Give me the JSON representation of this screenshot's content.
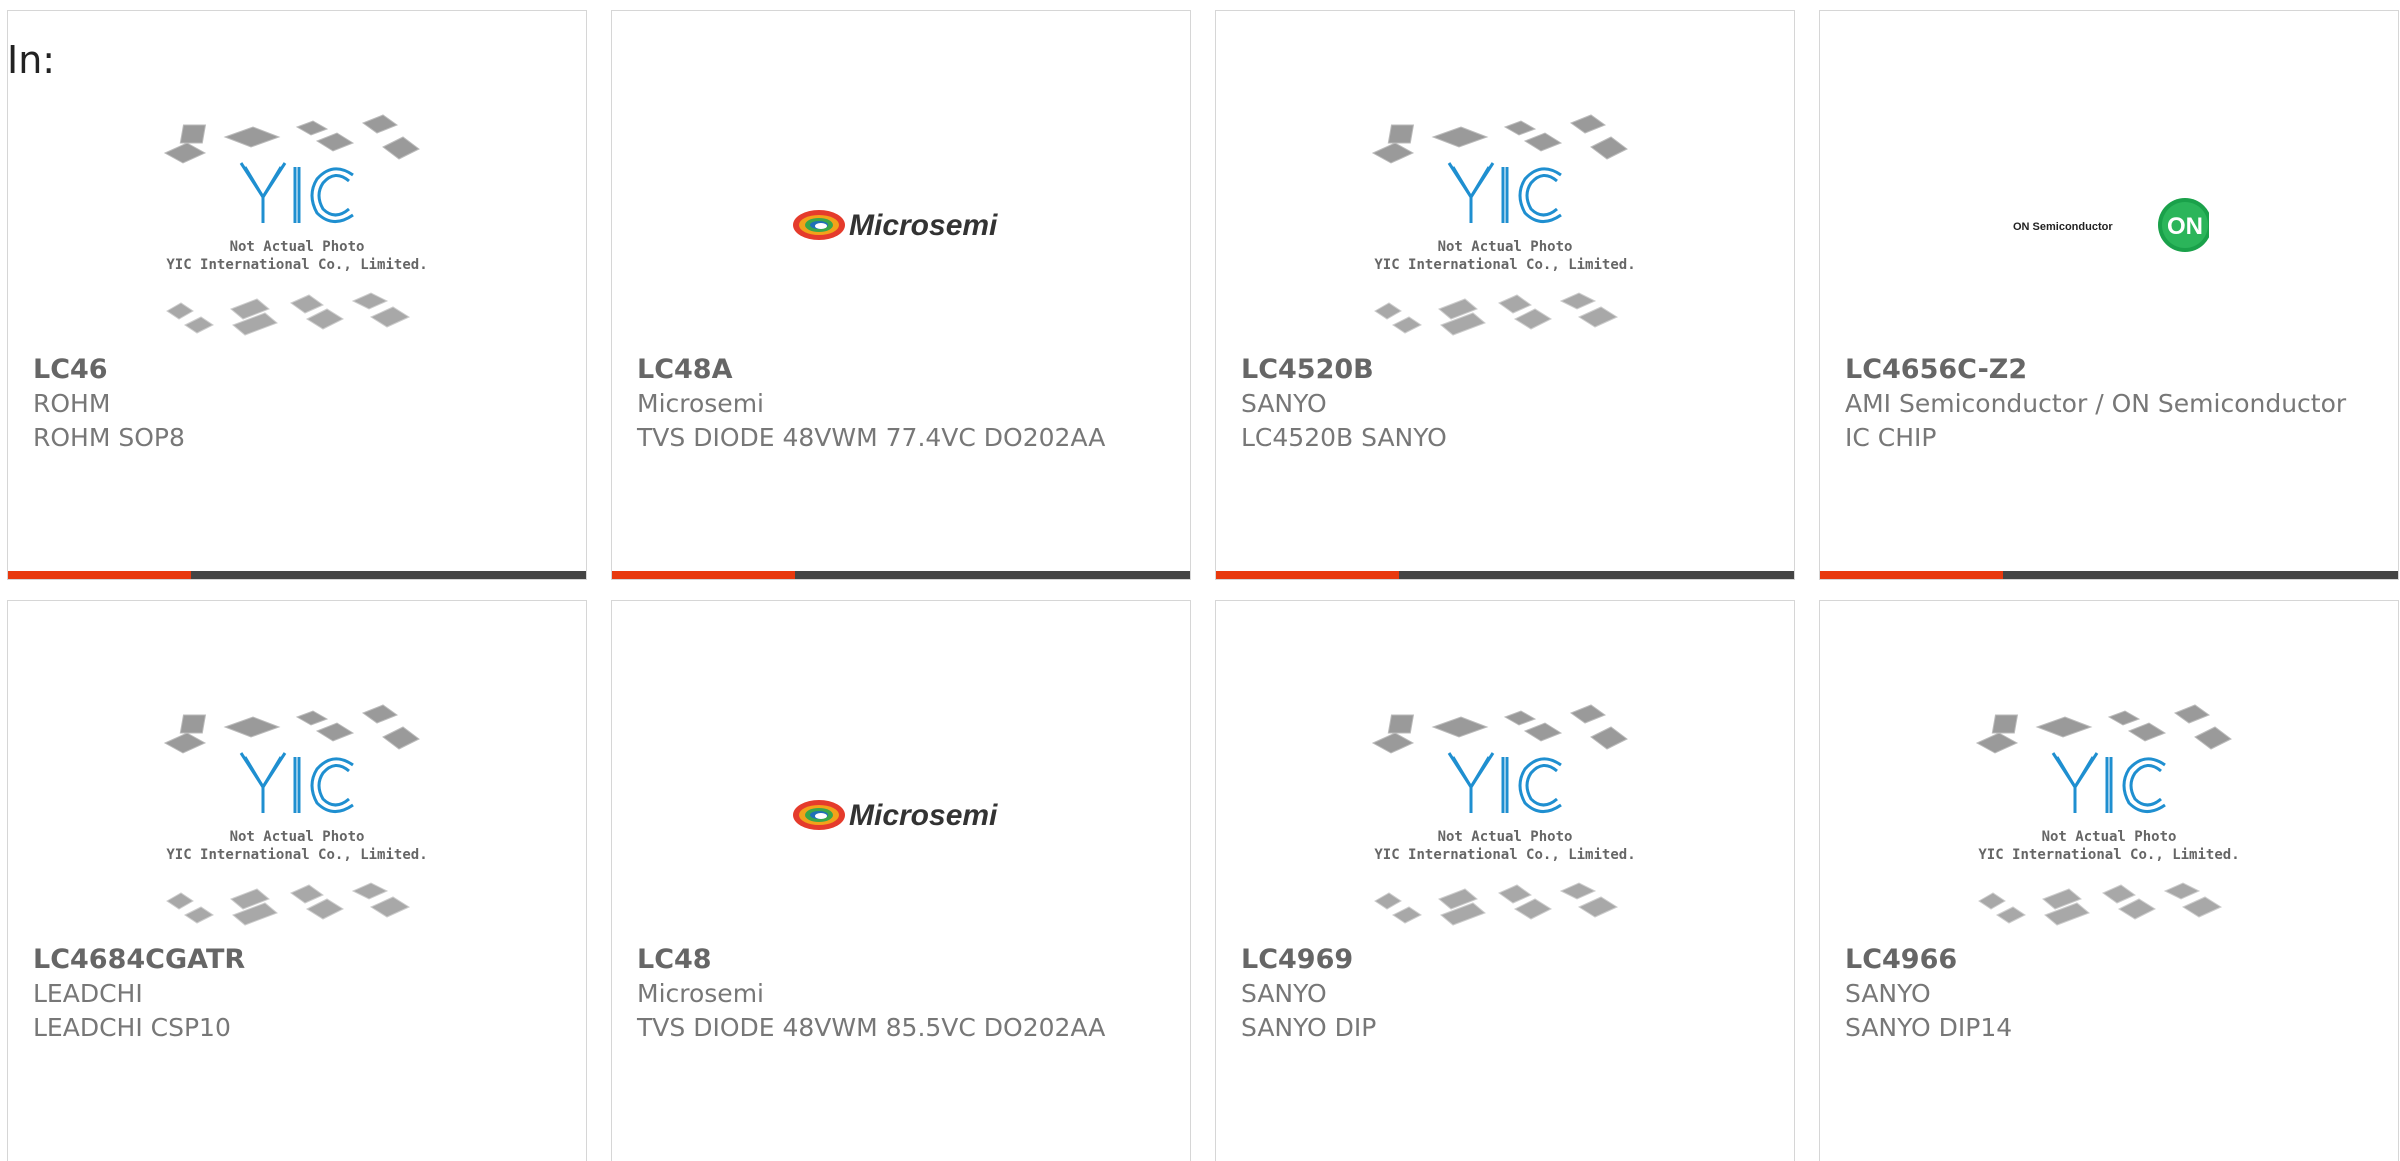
{
  "header": {
    "label": "In:"
  },
  "products": [
    {
      "part": "LC46",
      "manufacturer": "ROHM",
      "description": "ROHM SOP8",
      "image": "yic-placeholder"
    },
    {
      "part": "LC48A",
      "manufacturer": "Microsemi",
      "description": "TVS DIODE 48VWM 77.4VC DO202AA",
      "image": "microsemi-logo"
    },
    {
      "part": "LC4520B",
      "manufacturer": "SANYO",
      "description": "LC4520B SANYO",
      "image": "yic-placeholder"
    },
    {
      "part": "LC4656C-Z2",
      "manufacturer": "AMI Semiconductor / ON Semiconductor",
      "description": "IC CHIP",
      "image": "on-semiconductor-logo"
    },
    {
      "part": "LC4684CGATR",
      "manufacturer": "LEADCHI",
      "description": "LEADCHI CSP10",
      "image": "yic-placeholder"
    },
    {
      "part": "LC48",
      "manufacturer": "Microsemi",
      "description": "TVS DIODE 48VWM 85.5VC DO202AA",
      "image": "microsemi-logo"
    },
    {
      "part": "LC4969",
      "manufacturer": "SANYO",
      "description": "SANYO DIP",
      "image": "yic-placeholder"
    },
    {
      "part": "LC4966",
      "manufacturer": "SANYO",
      "description": "SANYO DIP14",
      "image": "yic-placeholder"
    }
  ],
  "placeholder": {
    "line1": "Not Actual Photo",
    "line2": "YIC International Co., Limited.",
    "logo_text": "YIC"
  },
  "logos": {
    "microsemi": "Microsemi",
    "on_semi": "ON Semiconductor",
    "on_badge": "ON"
  },
  "colors": {
    "accent": "#e8390e",
    "bar": "#444444",
    "yic_blue": "#1f8fd0",
    "on_green": "#1aa14a"
  }
}
